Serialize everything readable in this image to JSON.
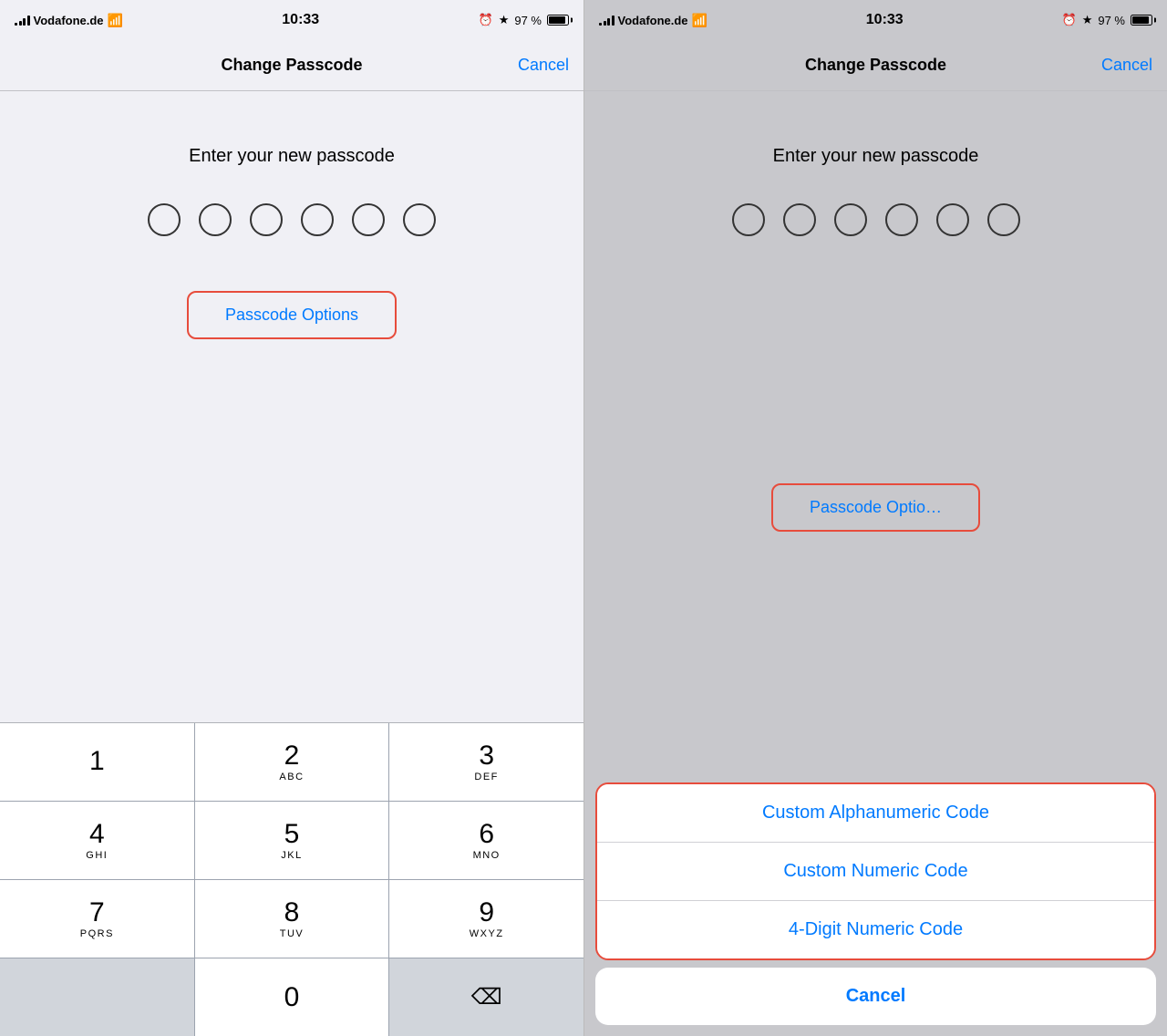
{
  "left_panel": {
    "status": {
      "carrier": "Vodafone.de",
      "time": "10:33",
      "battery_percent": "97 %"
    },
    "nav": {
      "title": "Change Passcode",
      "cancel_label": "Cancel"
    },
    "prompt": "Enter your new passcode",
    "dots_count": 6,
    "passcode_options_label": "Passcode Options",
    "numpad": [
      {
        "main": "1",
        "sub": ""
      },
      {
        "main": "2",
        "sub": "ABC"
      },
      {
        "main": "3",
        "sub": "DEF"
      },
      {
        "main": "4",
        "sub": "GHI"
      },
      {
        "main": "5",
        "sub": "JKL"
      },
      {
        "main": "6",
        "sub": "MNO"
      },
      {
        "main": "7",
        "sub": "PQRS"
      },
      {
        "main": "8",
        "sub": "TUV"
      },
      {
        "main": "9",
        "sub": "WXYZ"
      },
      {
        "main": "",
        "sub": ""
      },
      {
        "main": "0",
        "sub": ""
      },
      {
        "main": "⌫",
        "sub": ""
      }
    ]
  },
  "right_panel": {
    "status": {
      "carrier": "Vodafone.de",
      "time": "10:33",
      "battery_percent": "97 %"
    },
    "nav": {
      "title": "Change Passcode",
      "cancel_label": "Cancel"
    },
    "prompt": "Enter your new passcode",
    "dots_count": 6,
    "passcode_options_hint": "Passcode Optio...",
    "options_menu": {
      "items": [
        "Custom Alphanumeric Code",
        "Custom Numeric Code",
        "4-Digit Numeric Code"
      ],
      "cancel_label": "Cancel"
    }
  }
}
